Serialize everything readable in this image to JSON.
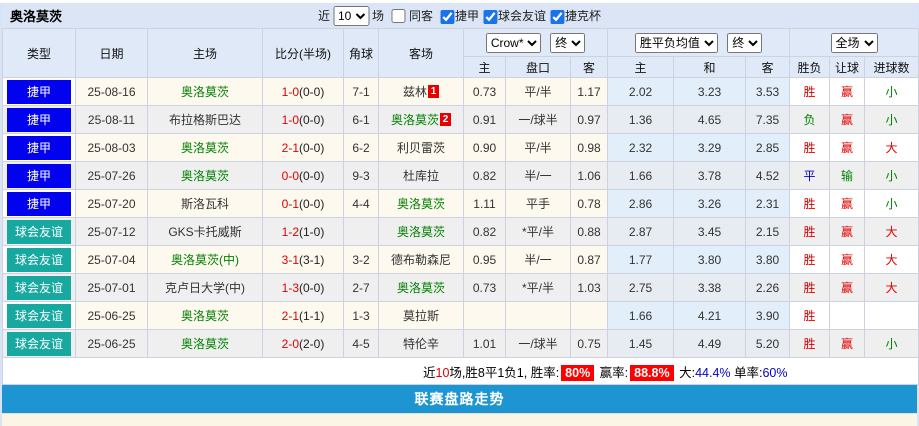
{
  "title": "奥洛莫茨",
  "controls": {
    "near_label": "近",
    "matches_value": "10",
    "matches_label": "场",
    "same_venue": {
      "label": "同客",
      "checked": false
    },
    "filters": [
      {
        "label": "捷甲",
        "checked": true
      },
      {
        "label": "球会友谊",
        "checked": true
      },
      {
        "label": "捷克杯",
        "checked": true
      }
    ]
  },
  "header": {
    "col_type": "类型",
    "col_date": "日期",
    "col_home": "主场",
    "col_score": "比分(半场)",
    "col_corner": "角球",
    "col_away": "客场",
    "odds_company_select": "Crow*",
    "odds_state_select": "终",
    "avg_select": "胜平负均值",
    "avg_state_select": "终",
    "scope_select": "全场",
    "sub_home": "主",
    "sub_handicap": "盘口",
    "sub_away": "客",
    "sub_avg_home": "主",
    "sub_avg_draw": "和",
    "sub_avg_away": "客",
    "sub_result": "胜负",
    "sub_let": "让球",
    "sub_goals": "进球数"
  },
  "colors": {
    "league_blue": "#0202ee",
    "friendly_teal": "#17a89f",
    "win_red": "#e00000",
    "lose_green": "#008000",
    "draw_blue": "#0000cc",
    "footer_blue": "#1e95d3"
  },
  "rows": [
    {
      "type": "捷甲",
      "tcls": "league",
      "date": "25-08-16",
      "home": "奥洛莫茨",
      "hG": true,
      "score": "1-0",
      "half": "(0-0)",
      "corner": "7-1",
      "away": "兹林",
      "aG": false,
      "badge": "1",
      "o1": "0.73",
      "pk": "平/半",
      "o2": "1.17",
      "a1": "2.02",
      "a2": "3.23",
      "a3": "3.53",
      "res": "胜",
      "resC": "red",
      "let": "赢",
      "letC": "red",
      "goal": "小",
      "goalC": "green"
    },
    {
      "type": "捷甲",
      "tcls": "league",
      "date": "25-08-11",
      "home": "布拉格斯巴达",
      "hG": false,
      "score": "1-0",
      "half": "(0-0)",
      "corner": "6-1",
      "away": "奥洛莫茨",
      "aG": true,
      "badge": "2",
      "o1": "0.91",
      "pk": "一/球半",
      "o2": "0.97",
      "a1": "1.36",
      "a2": "4.65",
      "a3": "7.35",
      "res": "负",
      "resC": "green",
      "let": "赢",
      "letC": "red",
      "goal": "小",
      "goalC": "green"
    },
    {
      "type": "捷甲",
      "tcls": "league",
      "date": "25-08-03",
      "home": "奥洛莫茨",
      "hG": true,
      "score": "2-1",
      "half": "(0-0)",
      "corner": "6-2",
      "away": "利贝雷茨",
      "aG": false,
      "badge": "",
      "o1": "0.90",
      "pk": "平/半",
      "o2": "0.98",
      "a1": "2.32",
      "a2": "3.29",
      "a3": "2.85",
      "res": "胜",
      "resC": "red",
      "let": "赢",
      "letC": "red",
      "goal": "大",
      "goalC": "red"
    },
    {
      "type": "捷甲",
      "tcls": "league",
      "date": "25-07-26",
      "home": "奥洛莫茨",
      "hG": true,
      "score": "0-0",
      "half": "(0-0)",
      "corner": "9-3",
      "away": "杜库拉",
      "aG": false,
      "badge": "",
      "o1": "0.82",
      "pk": "半/一",
      "o2": "1.06",
      "a1": "1.66",
      "a2": "3.78",
      "a3": "4.52",
      "res": "平",
      "resC": "blue",
      "let": "输",
      "letC": "green",
      "goal": "小",
      "goalC": "green"
    },
    {
      "type": "捷甲",
      "tcls": "league",
      "date": "25-07-20",
      "home": "斯洛瓦科",
      "hG": false,
      "score": "0-1",
      "half": "(0-0)",
      "corner": "4-4",
      "away": "奥洛莫茨",
      "aG": true,
      "badge": "",
      "o1": "1.11",
      "pk": "平手",
      "o2": "0.78",
      "a1": "2.86",
      "a2": "3.26",
      "a3": "2.31",
      "res": "胜",
      "resC": "red",
      "let": "赢",
      "letC": "red",
      "goal": "小",
      "goalC": "green"
    },
    {
      "type": "球会友谊",
      "tcls": "friendly",
      "date": "25-07-12",
      "home": "GKS卡托威斯",
      "hG": false,
      "score": "1-2",
      "half": "(1-0)",
      "corner": "",
      "away": "奥洛莫茨",
      "aG": true,
      "badge": "",
      "o1": "0.82",
      "pk": "*平/半",
      "o2": "0.88",
      "a1": "2.87",
      "a2": "3.45",
      "a3": "2.15",
      "res": "胜",
      "resC": "red",
      "let": "赢",
      "letC": "red",
      "goal": "大",
      "goalC": "red"
    },
    {
      "type": "球会友谊",
      "tcls": "friendly",
      "date": "25-07-04",
      "home": "奥洛莫茨(中)",
      "hG": true,
      "score": "3-1",
      "half": "(3-1)",
      "corner": "3-2",
      "away": "德布勒森尼",
      "aG": false,
      "badge": "",
      "o1": "0.95",
      "pk": "半/一",
      "o2": "0.87",
      "a1": "1.77",
      "a2": "3.80",
      "a3": "3.80",
      "res": "胜",
      "resC": "red",
      "let": "赢",
      "letC": "red",
      "goal": "大",
      "goalC": "red"
    },
    {
      "type": "球会友谊",
      "tcls": "friendly",
      "date": "25-07-01",
      "home": "克卢日大学(中)",
      "hG": false,
      "score": "1-3",
      "half": "(0-0)",
      "corner": "2-7",
      "away": "奥洛莫茨",
      "aG": true,
      "badge": "",
      "o1": "0.73",
      "pk": "*平/半",
      "o2": "1.03",
      "a1": "2.75",
      "a2": "3.38",
      "a3": "2.26",
      "res": "胜",
      "resC": "red",
      "let": "赢",
      "letC": "red",
      "goal": "大",
      "goalC": "red"
    },
    {
      "type": "球会友谊",
      "tcls": "friendly",
      "date": "25-06-25",
      "home": "奥洛莫茨",
      "hG": true,
      "score": "2-1",
      "half": "(1-1)",
      "corner": "1-3",
      "away": "莫拉斯",
      "aG": false,
      "badge": "",
      "o1": "",
      "pk": "",
      "o2": "",
      "a1": "1.66",
      "a2": "4.21",
      "a3": "3.90",
      "res": "胜",
      "resC": "red",
      "let": "",
      "letC": "",
      "goal": "",
      "goalC": ""
    },
    {
      "type": "球会友谊",
      "tcls": "friendly",
      "date": "25-06-25",
      "home": "奥洛莫茨",
      "hG": true,
      "score": "2-0",
      "half": "(2-0)",
      "corner": "4-5",
      "away": "特伦辛",
      "aG": false,
      "badge": "",
      "o1": "1.01",
      "pk": "一/球半",
      "o2": "0.75",
      "a1": "1.45",
      "a2": "4.49",
      "a3": "5.20",
      "res": "胜",
      "resC": "red",
      "let": "赢",
      "letC": "red",
      "goal": "小",
      "goalC": "green"
    }
  ],
  "summary": {
    "segments": [
      {
        "t": "近",
        "cls": ""
      },
      {
        "t": "10",
        "cls": "red"
      },
      {
        "t": "场,胜8平1负1, 胜率:",
        "cls": ""
      },
      {
        "t": "80%",
        "cls": "sumbadge"
      },
      {
        "t": " 赢率:",
        "cls": ""
      },
      {
        "t": "88.8%",
        "cls": "sumbadge"
      },
      {
        "t": " 大:",
        "cls": ""
      },
      {
        "t": "44.4%",
        "cls": "blue"
      },
      {
        "t": " 单率:",
        "cls": ""
      },
      {
        "t": "60%",
        "cls": "blue"
      }
    ]
  },
  "footer": {
    "label": "联赛盘路走势"
  }
}
